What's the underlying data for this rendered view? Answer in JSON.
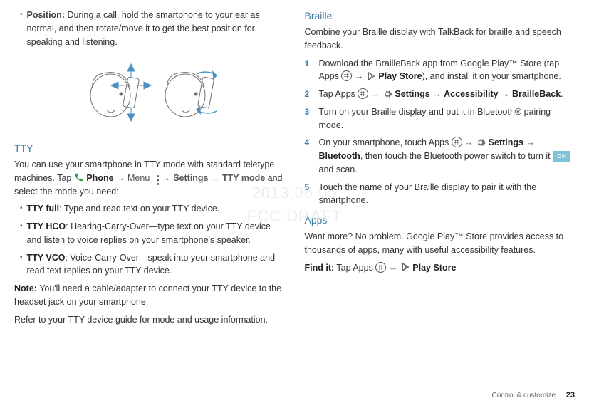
{
  "watermark": {
    "l1": "2013.06.05",
    "l2": "FCC DRAFT"
  },
  "left": {
    "position_label": "Position:",
    "position_text": " During a call, hold the smartphone to your ear as normal, and then rotate/move it to get the best position for speaking and listening.",
    "tty_head": "TTY",
    "tty_intro_a": "You can use your smartphone in TTY mode with standard teletype machines. Tap ",
    "tty_phone": " Phone",
    "tty_menu": " → Menu ",
    "tty_settings": " → Settings → TTY mode",
    "tty_intro_b": " and select the mode you need:",
    "tty_full_l": "TTY full",
    "tty_full_t": ": Type and read text on your TTY device.",
    "tty_hco_l": "TTY HCO",
    "tty_hco_t": ": Hearing-Carry-Over—type text on your TTY device and listen to voice replies on your smartphone's speaker.",
    "tty_vco_l": "TTY VCO",
    "tty_vco_t": ": Voice-Carry-Over—speak into your smartphone and read text replies on your TTY device.",
    "note_l": "Note:",
    "note_t": " You'll need a cable/adapter to connect your TTY device to the headset jack on your smartphone.",
    "refer": "Refer to your TTY device guide for mode and usage information."
  },
  "right": {
    "braille_head": "Braille",
    "braille_intro": "Combine your Braille display with TalkBack for braille and speech feedback.",
    "s1a": "Download the BrailleBack app from Google Play™ Store (tap Apps ",
    "s1b": " → ",
    "s1_play": " Play Store",
    "s1c": "), and install it on your smartphone.",
    "s2a": "Tap Apps ",
    "s2b": " → ",
    "s2_set": " Settings",
    "s2c": " → ",
    "s2_acc": "Accessibility",
    "s2d": " → ",
    "s2_bb": "BrailleBack",
    "s2e": ".",
    "s3": "Turn on your Braille display and put it in Bluetooth® pairing mode.",
    "s4a": "On your smartphone, touch Apps ",
    "s4b": " → ",
    "s4_set": " Settings",
    "s4c": " → ",
    "s4_bt": "Bluetooth",
    "s4d": ", then touch the Bluetooth power switch to turn it ",
    "s4_on": "ON",
    "s4e": " and scan.",
    "s5": "Touch the name of your Braille display to pair it with the smartphone.",
    "apps_head": "Apps",
    "apps_intro": "Want more? No problem. Google Play™ Store provides access to thousands of apps, many with useful accessibility features.",
    "find_l": "Find it:",
    "find_a": " Tap Apps ",
    "find_b": " → ",
    "find_play": " Play Store"
  },
  "footer": {
    "section": "Control & customize",
    "page": "23"
  }
}
